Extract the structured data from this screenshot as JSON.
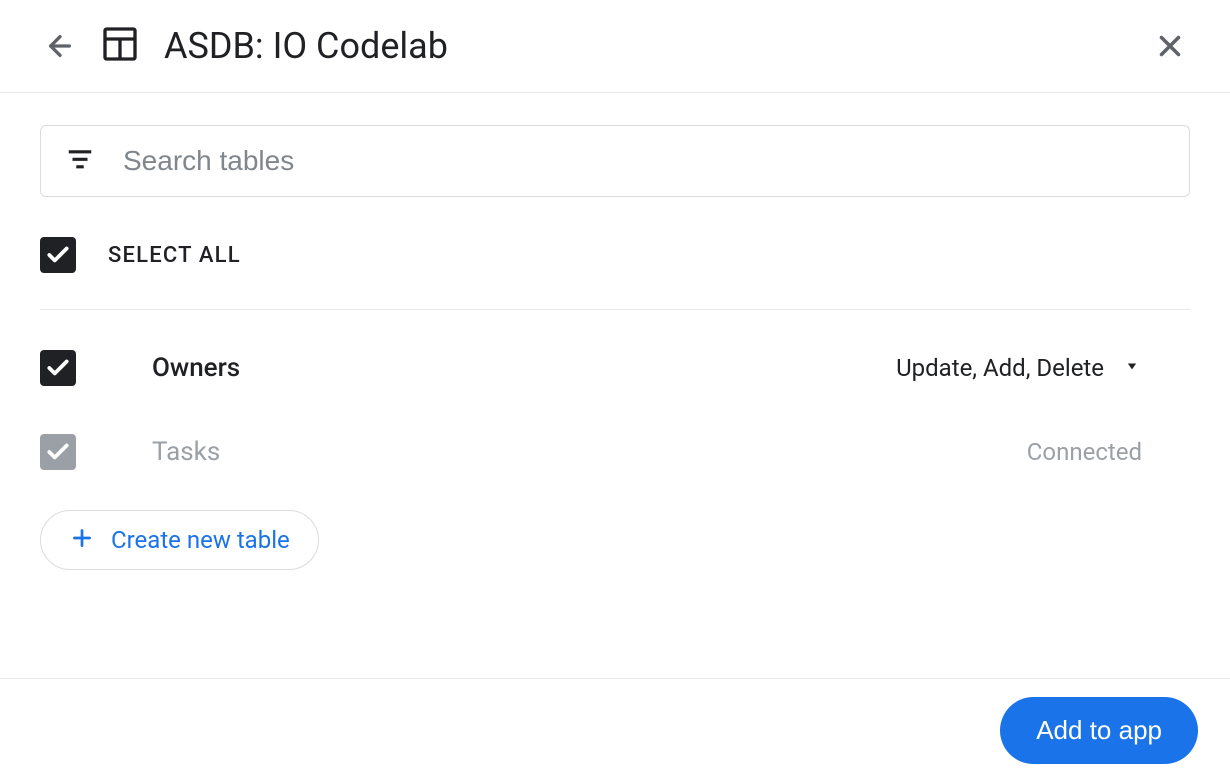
{
  "header": {
    "title": "ASDB: IO Codelab"
  },
  "search": {
    "placeholder": "Search tables"
  },
  "selectAll": {
    "label": "SELECT ALL",
    "checked": true
  },
  "tables": [
    {
      "name": "Owners",
      "checked": true,
      "disabled": false,
      "action": "Update, Add, Delete",
      "hasDropdown": true
    },
    {
      "name": "Tasks",
      "checked": true,
      "disabled": true,
      "action": "Connected",
      "hasDropdown": false
    }
  ],
  "createButton": {
    "label": "Create new table"
  },
  "footer": {
    "addButton": "Add to app"
  }
}
